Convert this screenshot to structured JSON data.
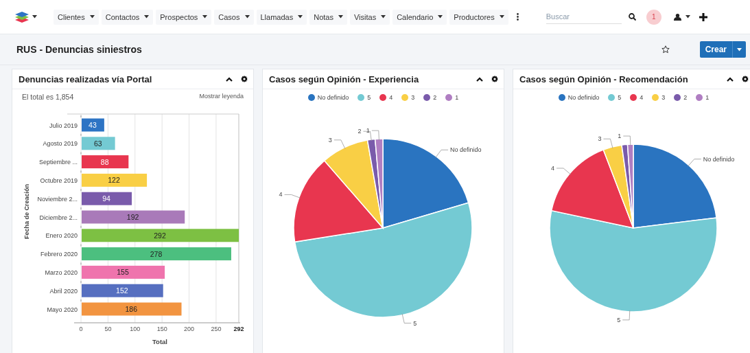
{
  "navbar": {
    "menu": [
      "Clientes",
      "Contactos",
      "Prospectos",
      "Casos",
      "Llamadas",
      "Notas",
      "Visitas",
      "Calendario",
      "Productores"
    ],
    "search": {
      "placeholder": "Buscar"
    },
    "notifications": "1"
  },
  "header": {
    "title": "RUS - Denuncias siniestros",
    "create_button": "Crear"
  },
  "panels": [
    {
      "kind": "bar",
      "title": "Denuncias realizadas vía Portal",
      "summary": "El total es 1,854",
      "legend_toggle": "Mostrar leyenda",
      "chart_data": {
        "type": "bar",
        "orientation": "horizontal",
        "ylabel": "Fecha de Creación",
        "xlabel": "Total",
        "categories": [
          "Julio 2019",
          "Agosto 2019",
          "Septiembre ...",
          "Octubre 2019",
          "Noviembre 2...",
          "Diciembre 2...",
          "Enero 2020",
          "Febrero 2020",
          "Marzo 2020",
          "Abril 2020",
          "Mayo 2020"
        ],
        "values": [
          43,
          63,
          88,
          122,
          94,
          192,
          292,
          278,
          155,
          152,
          186
        ],
        "grid": true,
        "xlim": [
          0,
          292
        ],
        "xticks": [
          0,
          50,
          100,
          150,
          200,
          250,
          {
            "value": 292,
            "label": "292"
          }
        ],
        "data_labels": true
      }
    },
    {
      "kind": "pie",
      "title": "Casos según Opinión - Experiencia",
      "slices": [
        {
          "legend": "No definido",
          "color": "#2a74c0",
          "callout": "No definido"
        },
        {
          "legend": "5",
          "color": "#74cad3",
          "callout": "5"
        },
        {
          "legend": "4",
          "color": "#e8364f",
          "callout": "4"
        },
        {
          "legend": "3",
          "color": "#f9cf45",
          "callout": "3"
        },
        {
          "legend": "2",
          "color": "#7a5bab",
          "callout": "2"
        },
        {
          "legend": "1",
          "color": "#b07ec2",
          "callout": "1"
        }
      ]
    },
    {
      "kind": "pie",
      "title": "Casos según Opinión - Recomendación",
      "slices": [
        {
          "legend": "No definido",
          "color": "#2a74c0",
          "callout": "No definido"
        },
        {
          "legend": "5",
          "color": "#74cad3",
          "callout": "5"
        },
        {
          "legend": "4",
          "color": "#e8364f",
          "callout": "4"
        },
        {
          "legend": "3",
          "color": "#f9cf45",
          "callout": "3"
        },
        {
          "legend": "2",
          "color": "#7a5bab"
        },
        {
          "legend": "1",
          "color": "#b07ec2",
          "callout": "1"
        }
      ]
    }
  ]
}
